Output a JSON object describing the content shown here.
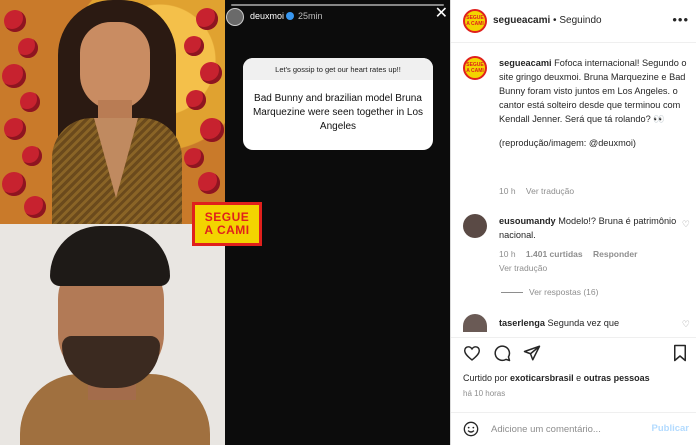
{
  "story": {
    "username": "deuxmoi",
    "time": "25min",
    "question_header": "Let's gossip to get our heart rates up!!",
    "question_text": "Bad Bunny and brazilian model Bruna Marquezine were seen together in Los Angeles"
  },
  "badge": {
    "line1": "SEGUE",
    "line2": "A CAMI"
  },
  "header": {
    "username": "segueacami",
    "separator": "•",
    "status": "Seguindo",
    "more_icon": "more-horizontal-icon"
  },
  "caption": {
    "username": "segueacami",
    "text": "Fofoca internacional! Segundo o site gringo deuxmoi. Bruna Marquezine e Bad Bunny foram visto juntos em Los Angeles. o cantor está solteiro desde que terminou com Kendall Jenner. Será que tá rolando? 👀",
    "credit": "(reprodução/imagem: @deuxmoi)",
    "time": "10 h",
    "translate": "Ver tradução"
  },
  "comments": [
    {
      "username": "eusoumandy",
      "text": "Modelo!? Bruna é patrimônio nacional.",
      "time": "10 h",
      "likes": "1.401 curtidas",
      "reply": "Responder",
      "translate": "Ver tradução",
      "replies": "Ver respostas (16)"
    },
    {
      "username": "taserlenga",
      "text": "Segunda vez que"
    }
  ],
  "actions": {
    "like_icon": "heart-icon",
    "comment_icon": "comment-icon",
    "share_icon": "send-icon",
    "save_icon": "bookmark-icon"
  },
  "likes": {
    "prefix": "Curtido por",
    "user": "exoticarsbrasil",
    "connector": "e",
    "others": "outras pessoas"
  },
  "post_time": "há 10 horas",
  "composer": {
    "placeholder": "Adicione um comentário...",
    "publish": "Publicar",
    "emoji_icon": "smiley-icon"
  },
  "colors": {
    "brand_yellow": "#f3d400",
    "brand_red": "#e0201c",
    "link_blue": "#385185"
  }
}
